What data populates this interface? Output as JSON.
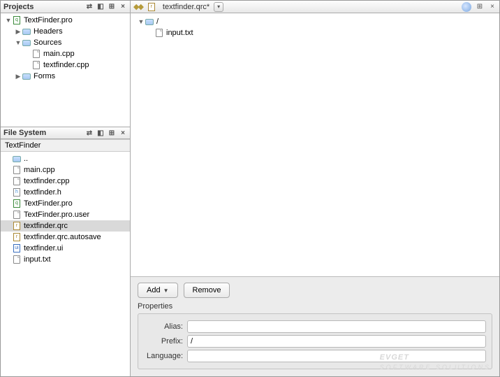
{
  "projects": {
    "title": "Projects",
    "items": [
      {
        "indent": 0,
        "disclosure": "▼",
        "icon": "pro",
        "label": "TextFinder.pro"
      },
      {
        "indent": 1,
        "disclosure": "▶",
        "icon": "folder",
        "label": "Headers"
      },
      {
        "indent": 1,
        "disclosure": "▼",
        "icon": "folder",
        "label": "Sources"
      },
      {
        "indent": 2,
        "disclosure": "",
        "icon": "file",
        "label": "main.cpp"
      },
      {
        "indent": 2,
        "disclosure": "",
        "icon": "file",
        "label": "textfinder.cpp"
      },
      {
        "indent": 1,
        "disclosure": "▶",
        "icon": "folder",
        "label": "Forms"
      }
    ]
  },
  "filesystem": {
    "title": "File System",
    "path": "TextFinder",
    "items": [
      {
        "icon": "folder",
        "label": ".."
      },
      {
        "icon": "file",
        "label": "main.cpp"
      },
      {
        "icon": "file",
        "label": "textfinder.cpp"
      },
      {
        "icon": "h",
        "label": "textfinder.h"
      },
      {
        "icon": "pro",
        "label": "TextFinder.pro"
      },
      {
        "icon": "file",
        "label": "TextFinder.pro.user"
      },
      {
        "icon": "qrc",
        "label": "textfinder.qrc",
        "selected": true
      },
      {
        "icon": "qrc",
        "label": "textfinder.qrc.autosave"
      },
      {
        "icon": "ui",
        "label": "textfinder.ui"
      },
      {
        "icon": "file",
        "label": "input.txt"
      }
    ]
  },
  "editor": {
    "tab_label": "textfinder.qrc*",
    "tree": [
      {
        "indent": 0,
        "disclosure": "▼",
        "icon": "folder",
        "label": "/"
      },
      {
        "indent": 1,
        "disclosure": "",
        "icon": "file",
        "label": "input.txt"
      }
    ]
  },
  "bottom": {
    "add_label": "Add",
    "remove_label": "Remove",
    "properties_label": "Properties",
    "alias_label": "Alias:",
    "prefix_label": "Prefix:",
    "language_label": "Language:",
    "alias_value": "",
    "prefix_value": "/",
    "language_value": ""
  },
  "watermark": {
    "line1": "EVGET",
    "line2": "SOFTWARE SOLUTIONS"
  }
}
